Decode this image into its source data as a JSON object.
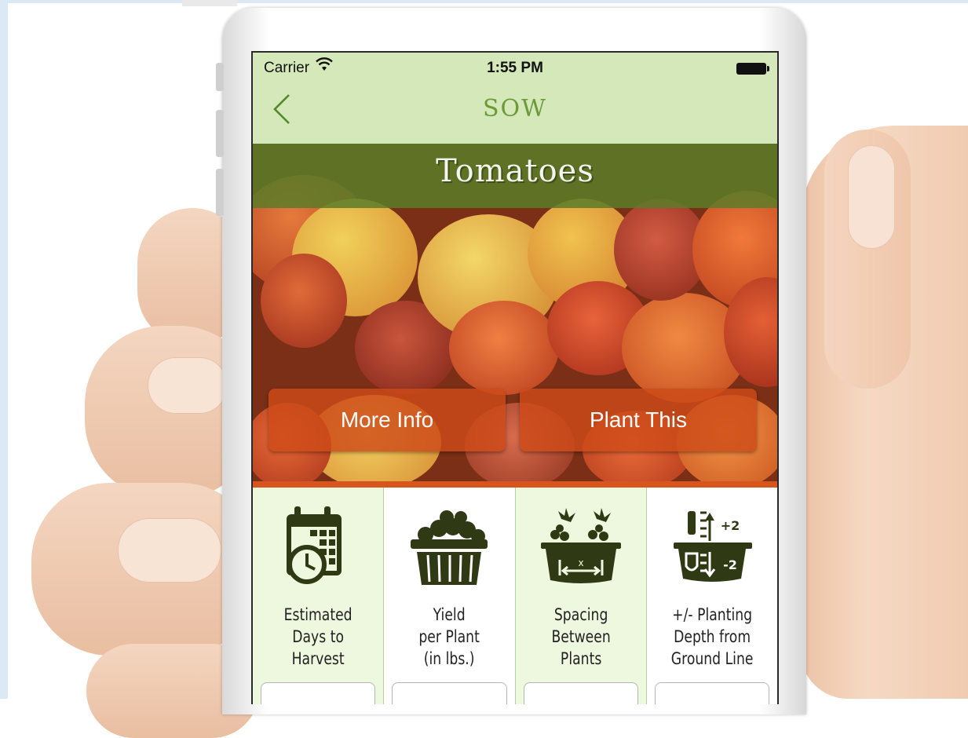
{
  "status_bar": {
    "carrier": "Carrier",
    "time": "1:55 PM"
  },
  "nav": {
    "title": "SOW",
    "back_icon": "chevron-left-icon"
  },
  "plant": {
    "name": "Tomatoes"
  },
  "actions": {
    "more_info": "More Info",
    "plant_this": "Plant This"
  },
  "tiles": [
    {
      "icon": "calendar-clock-icon",
      "lines": [
        "Estimated",
        "Days to",
        "Harvest"
      ]
    },
    {
      "icon": "basket-icon",
      "lines": [
        "Yield",
        "per Plant",
        "(in lbs.)"
      ]
    },
    {
      "icon": "spacing-icon",
      "icon_text": "x",
      "lines": [
        "Spacing",
        "Between",
        "Plants"
      ]
    },
    {
      "icon": "depth-icon",
      "icon_text_up": "+2",
      "icon_text_down": "-2",
      "lines": [
        "+/- Planting",
        "Depth from",
        "Ground Line"
      ]
    }
  ],
  "colors": {
    "nav_bg": "#d4e8b9",
    "title_green": "#6c9a38",
    "banner_green": "#5a7d28",
    "button_orange": "#cd4b19",
    "accent_line": "#d8561d",
    "icon_dark": "#2f3a14"
  }
}
